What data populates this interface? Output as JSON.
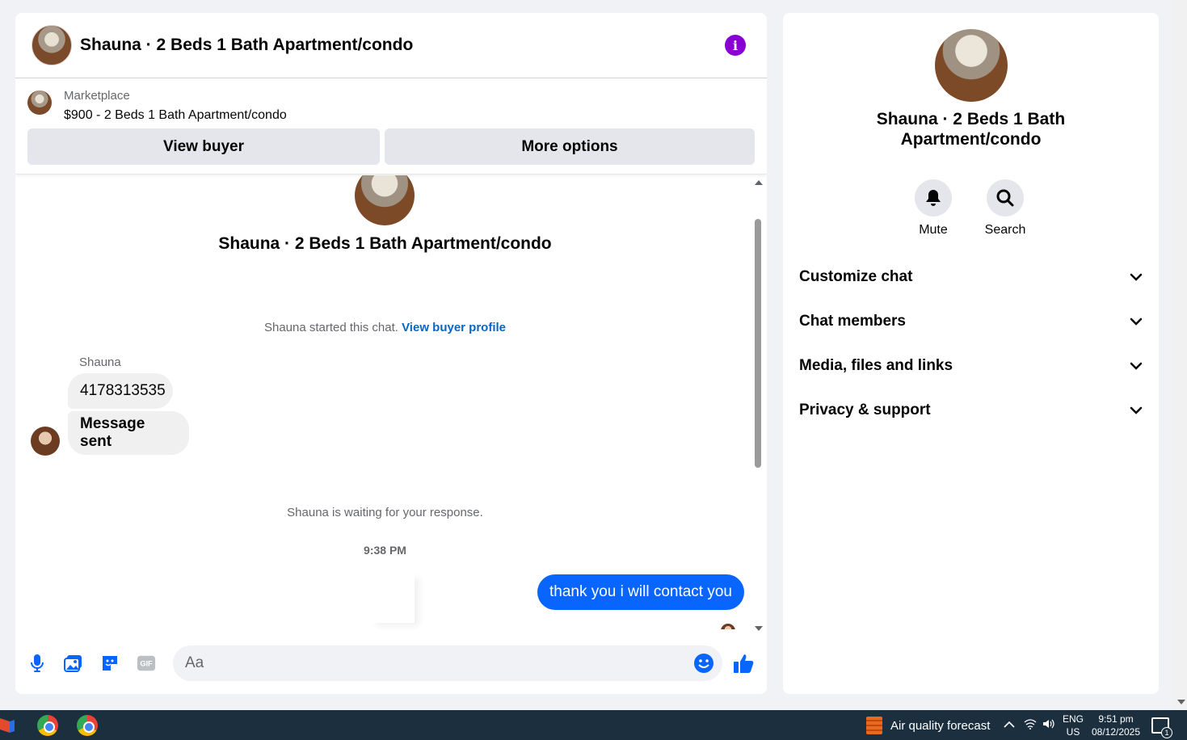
{
  "header": {
    "title": "Shauna · 2 Beds 1 Bath Apartment/condo",
    "info_icon": "info-icon"
  },
  "marketplace": {
    "label": "Marketplace",
    "listing": "$900 - 2 Beds 1 Bath Apartment/condo",
    "view_buyer_label": "View buyer",
    "more_options_label": "More options"
  },
  "conversation": {
    "intro_title": "Shauna · 2 Beds 1 Bath Apartment/condo",
    "started_text": "Shauna started this chat.",
    "view_profile_link": "View buyer profile",
    "sender_name": "Shauna",
    "messages_in": [
      "4178313535",
      "Message sent"
    ],
    "waiting_text": "Shauna is waiting for your response.",
    "timestamp": "9:38 PM",
    "message_out": "thank you i will contact you"
  },
  "composer": {
    "placeholder": "Aa",
    "icons": [
      "microphone-icon",
      "photo-icon",
      "sticker-icon",
      "gif-icon",
      "emoji-icon",
      "thumbs-up-icon"
    ]
  },
  "info_panel": {
    "title": "Shauna · 2 Beds 1 Bath Apartment/condo",
    "mute_label": "Mute",
    "search_label": "Search",
    "sections": [
      "Customize chat",
      "Chat members",
      "Media, files and links",
      "Privacy & support"
    ]
  },
  "taskbar": {
    "weather": "Air quality forecast",
    "lang_top": "ENG",
    "lang_bottom": "US",
    "time": "9:51 pm",
    "date": "08/12/2025",
    "notification_count": "1"
  },
  "colors": {
    "accent_blue": "#0866ff",
    "link_blue": "#0a66c2",
    "info_purple": "#8a00d4",
    "taskbar": "#1c2f3f"
  }
}
